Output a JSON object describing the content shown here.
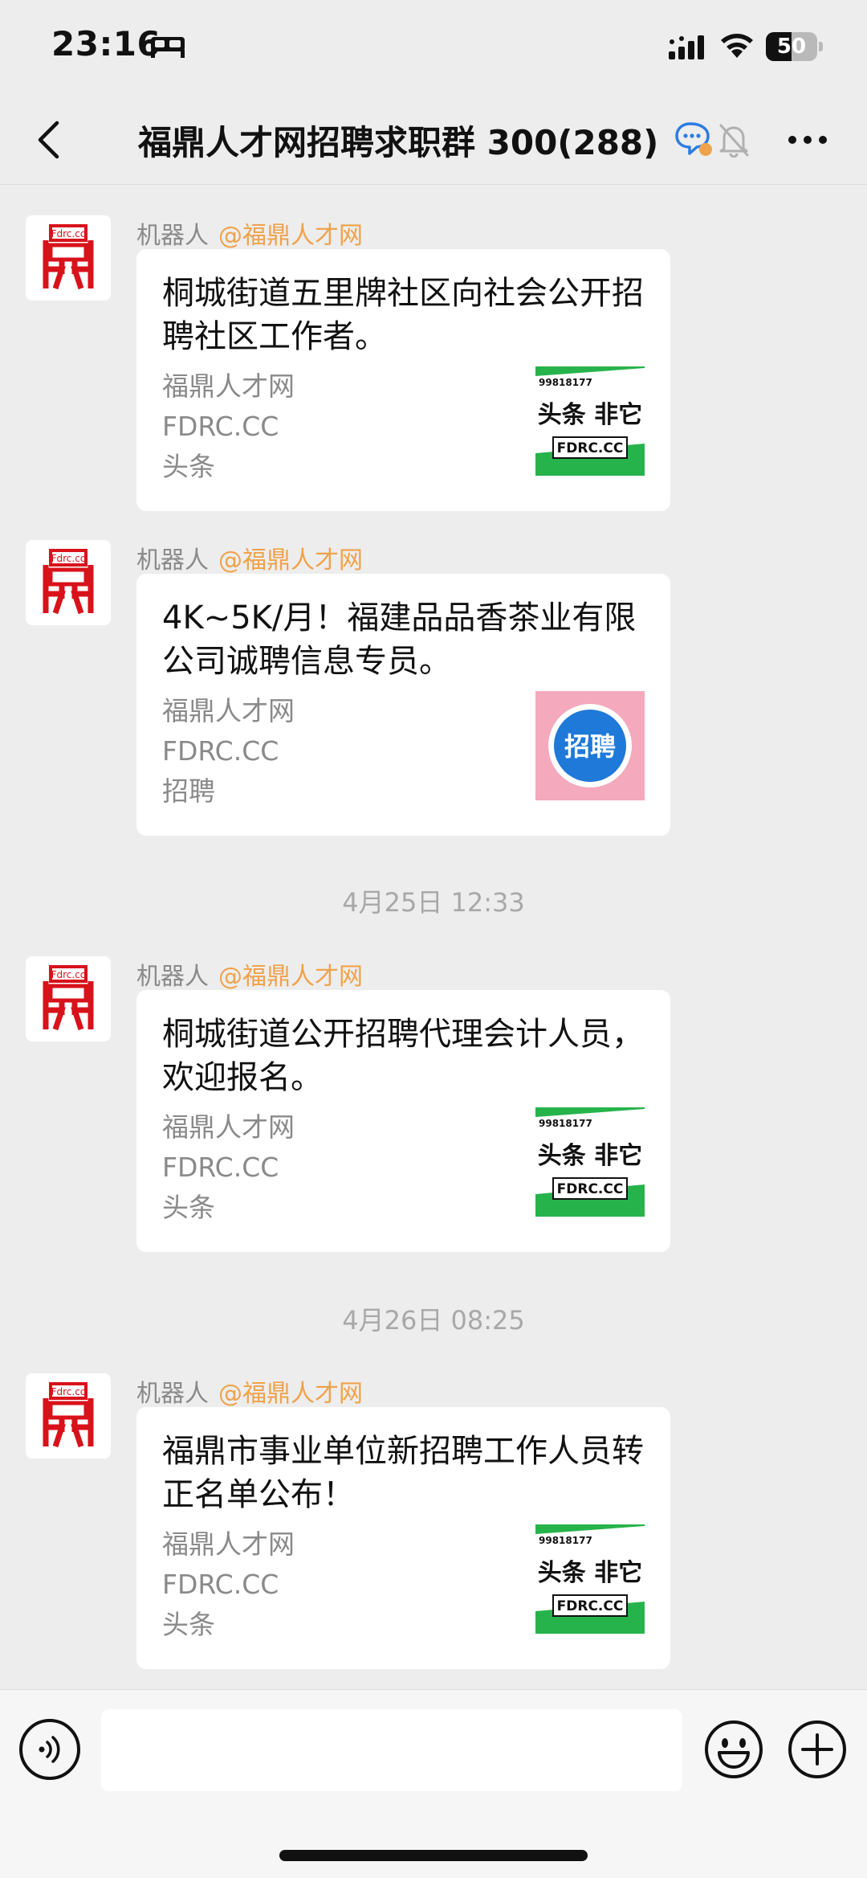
{
  "status_bar": {
    "time": "23:16",
    "battery_level": "50",
    "battery_fraction": 0.5
  },
  "nav": {
    "title": "福鼎人才网招聘求职群 300(288)"
  },
  "messages": [
    {
      "sender": "机器人",
      "mention": "@福鼎人才网",
      "avatar_text": "Fdrc.cc",
      "title": "桐城街道五里牌社区向社会公开招聘社区工作者。",
      "source": "福鼎人才网",
      "domain": "FDRC.CC",
      "category": "头条",
      "thumb": {
        "top": "99818177",
        "main": "头条 非它",
        "bottom": "FDRC.CC"
      }
    },
    {
      "sender": "机器人",
      "mention": "@福鼎人才网",
      "avatar_text": "Fdrc.cc",
      "title": "4K~5K/月！福建品品香茶业有限公司诚聘信息专员。",
      "source": "福鼎人才网",
      "domain": "FDRC.CC",
      "category": "招聘",
      "thumb": {
        "main": "招聘"
      }
    },
    {
      "sender": "机器人",
      "mention": "@福鼎人才网",
      "avatar_text": "Fdrc.cc",
      "title": "桐城街道公开招聘代理会计人员，欢迎报名。",
      "source": "福鼎人才网",
      "domain": "FDRC.CC",
      "category": "头条",
      "thumb": {
        "top": "99818177",
        "main": "头条 非它",
        "bottom": "FDRC.CC"
      }
    },
    {
      "sender": "机器人",
      "mention": "@福鼎人才网",
      "avatar_text": "Fdrc.cc",
      "title": "福鼎市事业单位新招聘工作人员转正名单公布！",
      "source": "福鼎人才网",
      "domain": "FDRC.CC",
      "category": "头条",
      "thumb": {
        "top": "99818177",
        "main": "头条 非它",
        "bottom": "FDRC.CC"
      }
    }
  ],
  "time_dividers": [
    "4月25日 12:33",
    "4月26日 08:25"
  ],
  "input": {
    "placeholder": ""
  },
  "icons": {
    "back": "chevron-left-icon",
    "chat": "chat-bubble-icon",
    "mute": "bell-off-icon",
    "more": "more-icon",
    "voice": "voice-icon",
    "emoji": "emoji-icon",
    "add": "plus-icon"
  },
  "colors": {
    "mention": "#f0a24a",
    "logo_red": "#d8121b",
    "thumb_green": "#27b34b",
    "thumb_pink": "#f4a9bd",
    "thumb_blue": "#1f79d9"
  }
}
